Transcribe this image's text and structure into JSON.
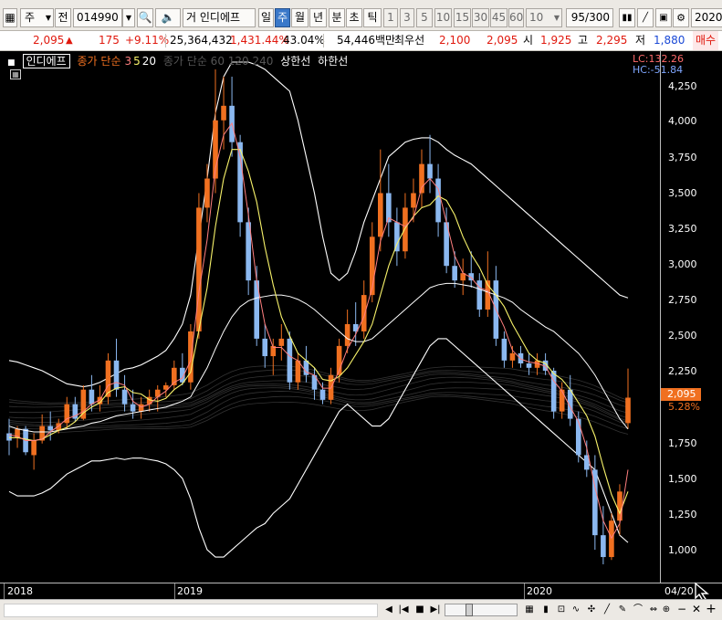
{
  "toolbar": {
    "market_label": "주",
    "type_label": "전",
    "stock_code": "014990",
    "stock_name": "인디에프",
    "stock_prefix": "거",
    "periods": [
      "일",
      "주",
      "월",
      "년",
      "분",
      "초",
      "틱"
    ],
    "active_period": "주",
    "intervals": [
      "1",
      "3",
      "5",
      "10",
      "15",
      "30",
      "45",
      "60"
    ],
    "interval_value": "10",
    "count_display": "95/300",
    "date_value": "2020/"
  },
  "infobar": {
    "price": "2,095",
    "change": "175",
    "change_pct": "+9.11%",
    "volume": "25,364,432",
    "volume_pct": "1,431.44%",
    "turnover": "43.04%",
    "amount": "54,446백만",
    "priority_label": "최우선",
    "priority_value": "2,100",
    "priority_value2": "2,095",
    "open_label": "시",
    "open_value": "1,925",
    "high_label": "고",
    "high_value": "2,295",
    "low_label": "저",
    "low_value": "1,880",
    "action_label": "매수"
  },
  "legend": {
    "indicator_name": "인디에프",
    "ma_label": "종가 단순",
    "ma_periods": [
      "3",
      "5",
      "20"
    ],
    "faded_text": "종가 단순 60 120 240",
    "upper_label": "상한선",
    "lower_label": "하한선"
  },
  "lc_hc": {
    "lc": "LC:132.26",
    "hc": "HC:-51.84"
  },
  "price_axis": {
    "labels": [
      "4,250",
      "4,000",
      "3,750",
      "3,500",
      "3,250",
      "3,000",
      "2,750",
      "2,500",
      "2,250",
      "1,750",
      "1,500",
      "1,250",
      "1,000"
    ],
    "current_price": "2,095",
    "current_pct": "5.28%"
  },
  "date_axis": {
    "labels": [
      "2018",
      "2019",
      "2020",
      "04/20"
    ]
  },
  "colors": {
    "up": "#f07020",
    "down": "#8bb8f0",
    "ma3": "#ff7f7f",
    "ma5": "#f7f26a",
    "ma20": "#ffffff",
    "band": "#ffffff"
  },
  "chart_data": {
    "type": "candlestick",
    "ylim": [
      900,
      4400
    ],
    "ohlc": [
      [
        1850,
        1950,
        1700,
        1800
      ],
      [
        1820,
        1900,
        1750,
        1880
      ],
      [
        1880,
        1900,
        1700,
        1720
      ],
      [
        1700,
        1850,
        1600,
        1800
      ],
      [
        1800,
        1980,
        1780,
        1900
      ],
      [
        1900,
        2000,
        1800,
        1870
      ],
      [
        1870,
        1950,
        1850,
        1920
      ],
      [
        1920,
        2100,
        1880,
        2050
      ],
      [
        2050,
        2100,
        1930,
        1950
      ],
      [
        1950,
        2180,
        1940,
        2150
      ],
      [
        2150,
        2250,
        2000,
        2050
      ],
      [
        2050,
        2180,
        2000,
        2100
      ],
      [
        2100,
        2400,
        2050,
        2350
      ],
      [
        2350,
        2500,
        2100,
        2150
      ],
      [
        2150,
        2250,
        2000,
        2050
      ],
      [
        2050,
        2150,
        1950,
        2000
      ],
      [
        2000,
        2100,
        1950,
        2050
      ],
      [
        2050,
        2150,
        2000,
        2100
      ],
      [
        2100,
        2180,
        2000,
        2150
      ],
      [
        2150,
        2200,
        2100,
        2180
      ],
      [
        2180,
        2350,
        2150,
        2300
      ],
      [
        2300,
        2400,
        2180,
        2200
      ],
      [
        2200,
        2600,
        2150,
        2550
      ],
      [
        2550,
        3500,
        2500,
        3400
      ],
      [
        3400,
        3700,
        3300,
        3600
      ],
      [
        3600,
        4350,
        3500,
        4000
      ],
      [
        4000,
        4300,
        3800,
        4100
      ],
      [
        4100,
        4300,
        3750,
        3850
      ],
      [
        3850,
        3900,
        3200,
        3300
      ],
      [
        3300,
        3400,
        2800,
        2900
      ],
      [
        2900,
        3000,
        2450,
        2500
      ],
      [
        2500,
        2600,
        2300,
        2380
      ],
      [
        2380,
        2500,
        2250,
        2450
      ],
      [
        2450,
        2600,
        2350,
        2500
      ],
      [
        2500,
        2550,
        2150,
        2200
      ],
      [
        2200,
        2400,
        2150,
        2350
      ],
      [
        2350,
        2450,
        2200,
        2250
      ],
      [
        2250,
        2300,
        2080,
        2150
      ],
      [
        2150,
        2200,
        2050,
        2080
      ],
      [
        2080,
        2300,
        2050,
        2250
      ],
      [
        2250,
        2500,
        2200,
        2450
      ],
      [
        2450,
        2700,
        2400,
        2600
      ],
      [
        2600,
        2750,
        2450,
        2550
      ],
      [
        2550,
        2900,
        2500,
        2800
      ],
      [
        2800,
        3300,
        2750,
        3200
      ],
      [
        3200,
        3800,
        3100,
        3500
      ],
      [
        3500,
        3700,
        3200,
        3300
      ],
      [
        3300,
        3400,
        3000,
        3100
      ],
      [
        3100,
        3500,
        3050,
        3400
      ],
      [
        3400,
        3600,
        3300,
        3500
      ],
      [
        3500,
        3800,
        3400,
        3700
      ],
      [
        3700,
        3900,
        3500,
        3600
      ],
      [
        3600,
        3700,
        3200,
        3300
      ],
      [
        3300,
        3400,
        2950,
        3000
      ],
      [
        3000,
        3100,
        2850,
        2900
      ],
      [
        2900,
        3050,
        2800,
        2950
      ],
      [
        2950,
        3100,
        2850,
        2900
      ],
      [
        2900,
        2950,
        2650,
        2700
      ],
      [
        2700,
        3100,
        2650,
        2900
      ],
      [
        2900,
        3000,
        2450,
        2500
      ],
      [
        2500,
        2550,
        2300,
        2350
      ],
      [
        2350,
        2450,
        2300,
        2400
      ],
      [
        2400,
        2450,
        2300,
        2330
      ],
      [
        2330,
        2400,
        2250,
        2300
      ],
      [
        2300,
        2400,
        2250,
        2350
      ],
      [
        2350,
        2400,
        2250,
        2280
      ],
      [
        2280,
        2300,
        1950,
        2000
      ],
      [
        2000,
        2200,
        1950,
        2150
      ],
      [
        2150,
        2250,
        1900,
        1950
      ],
      [
        1950,
        2000,
        1650,
        1700
      ],
      [
        1700,
        1800,
        1550,
        1600
      ],
      [
        1600,
        1700,
        1050,
        1150
      ],
      [
        1150,
        1350,
        950,
        1000
      ],
      [
        1000,
        1300,
        980,
        1250
      ],
      [
        1250,
        1500,
        1150,
        1450
      ],
      [
        1920,
        2295,
        1880,
        2095
      ]
    ],
    "ma3": [
      1840,
      1830,
      1800,
      1800,
      1810,
      1860,
      1900,
      1950,
      1970,
      2000,
      2050,
      2080,
      2180,
      2200,
      2180,
      2070,
      2030,
      2050,
      2100,
      2140,
      2200,
      2230,
      2350,
      2820,
      3180,
      3670,
      3900,
      3980,
      3750,
      3350,
      2900,
      2600,
      2440,
      2440,
      2380,
      2350,
      2270,
      2250,
      2160,
      2160,
      2280,
      2430,
      2530,
      2650,
      2850,
      3170,
      3330,
      3300,
      3270,
      3330,
      3540,
      3600,
      3530,
      3300,
      3070,
      2950,
      2920,
      2850,
      2830,
      2700,
      2580,
      2420,
      2360,
      2340,
      2330,
      2310,
      2210,
      2140,
      2030,
      1930,
      1750,
      1480,
      1250,
      1130,
      1230,
      1600
    ],
    "ma5": [
      1820,
      1820,
      1810,
      1800,
      1810,
      1840,
      1870,
      1890,
      1930,
      1990,
      2030,
      2060,
      2130,
      2160,
      2170,
      2130,
      2120,
      2080,
      2070,
      2090,
      2150,
      2190,
      2270,
      2560,
      2850,
      3270,
      3600,
      3800,
      3800,
      3650,
      3440,
      3130,
      2870,
      2650,
      2520,
      2400,
      2350,
      2300,
      2220,
      2210,
      2240,
      2300,
      2390,
      2480,
      2600,
      2800,
      3000,
      3150,
      3260,
      3340,
      3400,
      3420,
      3480,
      3450,
      3350,
      3200,
      3080,
      2990,
      2870,
      2800,
      2720,
      2600,
      2500,
      2400,
      2350,
      2330,
      2260,
      2220,
      2150,
      2060,
      1970,
      1830,
      1620,
      1430,
      1300,
      1450
    ],
    "ma20": [
      1900,
      1880,
      1870,
      1860,
      1860,
      1860,
      1870,
      1880,
      1890,
      1900,
      1920,
      1930,
      1950,
      1970,
      1980,
      1990,
      2000,
      2010,
      2020,
      2030,
      2050,
      2070,
      2100,
      2200,
      2300,
      2430,
      2550,
      2650,
      2720,
      2760,
      2780,
      2790,
      2800,
      2800,
      2790,
      2770,
      2740,
      2700,
      2650,
      2600,
      2550,
      2500,
      2480,
      2480,
      2500,
      2550,
      2600,
      2650,
      2700,
      2750,
      2800,
      2850,
      2870,
      2880,
      2880,
      2870,
      2860,
      2840,
      2820,
      2800,
      2780,
      2750,
      2700,
      2660,
      2620,
      2580,
      2550,
      2500,
      2450,
      2400,
      2330,
      2250,
      2150,
      2050,
      1950,
      1880
    ],
    "upper": [
      2350,
      2340,
      2320,
      2300,
      2280,
      2250,
      2220,
      2190,
      2180,
      2170,
      2180,
      2200,
      2230,
      2260,
      2290,
      2300,
      2320,
      2350,
      2380,
      2420,
      2500,
      2600,
      2800,
      3200,
      3600,
      4050,
      4300,
      4400,
      4400,
      4400,
      4380,
      4350,
      4300,
      4250,
      4200,
      4000,
      3750,
      3500,
      3200,
      2950,
      2900,
      2950,
      3100,
      3300,
      3450,
      3600,
      3750,
      3800,
      3850,
      3870,
      3880,
      3880,
      3850,
      3800,
      3760,
      3730,
      3700,
      3650,
      3600,
      3550,
      3500,
      3450,
      3400,
      3350,
      3300,
      3250,
      3200,
      3150,
      3100,
      3050,
      3000,
      2950,
      2900,
      2850,
      2800,
      2780
    ],
    "lower": [
      1450,
      1420,
      1420,
      1420,
      1440,
      1470,
      1520,
      1570,
      1600,
      1630,
      1660,
      1660,
      1670,
      1680,
      1670,
      1680,
      1680,
      1670,
      1660,
      1640,
      1600,
      1540,
      1400,
      1200,
      1050,
      1000,
      1000,
      1050,
      1100,
      1150,
      1200,
      1230,
      1300,
      1350,
      1400,
      1500,
      1600,
      1700,
      1800,
      1900,
      2000,
      2050,
      2000,
      1950,
      1900,
      1900,
      1950,
      2050,
      2150,
      2250,
      2350,
      2450,
      2500,
      2500,
      2450,
      2400,
      2350,
      2300,
      2250,
      2200,
      2150,
      2100,
      2050,
      2000,
      1950,
      1900,
      1850,
      1800,
      1750,
      1700,
      1650,
      1600,
      1450,
      1300,
      1150,
      1100
    ],
    "upper_label": "상한선",
    "lower_label": "하한선",
    "xlabel": "",
    "ylabel": ""
  }
}
